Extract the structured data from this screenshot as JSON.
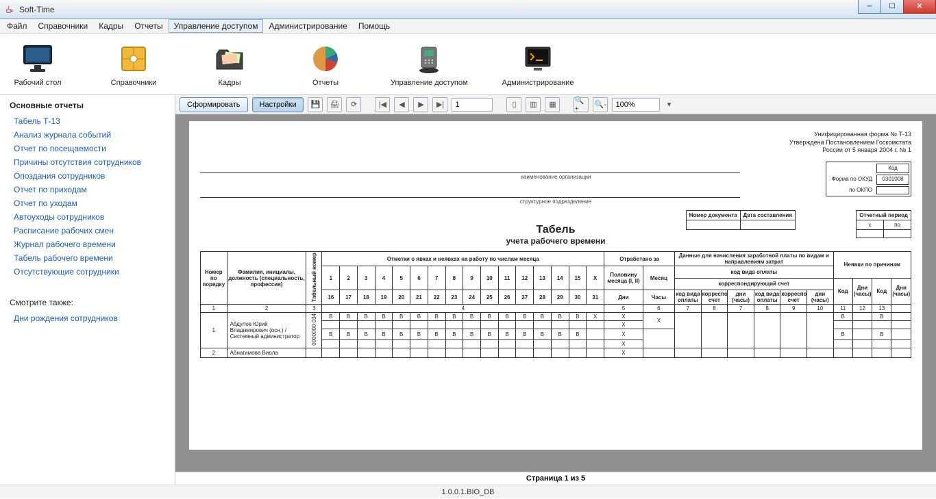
{
  "window": {
    "title": "Soft-Time"
  },
  "menu": {
    "items": [
      "Файл",
      "Справочники",
      "Кадры",
      "Отчеты",
      "Управление доступом",
      "Администрирование",
      "Помощь"
    ],
    "active_index": 4
  },
  "toolstrip": [
    {
      "label": "Рабочий стол",
      "icon": "monitor-icon"
    },
    {
      "label": "Справочники",
      "icon": "archive-icon"
    },
    {
      "label": "Кадры",
      "icon": "folder-people-icon"
    },
    {
      "label": "Отчеты",
      "icon": "pie-chart-icon"
    },
    {
      "label": "Управление доступом",
      "icon": "fingerprint-device-icon"
    },
    {
      "label": "Администрирование",
      "icon": "terminal-icon"
    }
  ],
  "sidebar": {
    "heading1": "Основные отчеты",
    "links1": [
      "Табель Т-13",
      "Анализ журнала событий",
      "Отчет по посещаемости",
      "Причины отсутствия сотрудников",
      "Опоздания сотрудников",
      "Отчет по приходам",
      "Отчет по уходам",
      "Автоуходы сотрудников",
      "Расписание рабочих смен",
      "Журнал рабочего времени",
      "Табель рабочего времени",
      "Отсутствующие сотрудники"
    ],
    "heading2": "Смотрите также:",
    "links2": [
      "Дни рождения сотрудников"
    ]
  },
  "report_toolbar": {
    "btn_generate": "Сформировать",
    "btn_settings": "Настройки",
    "page_value": "1",
    "zoom_value": "100%"
  },
  "report": {
    "form_line1": "Унифицированная форма № Т-13",
    "form_line2": "Утверждена Постановлением Госкомстата",
    "form_line3": "России от 5 января 2004 г. № 1",
    "code_label": "Код",
    "okud_label": "Форма по ОКУД",
    "okud_value": "0301008",
    "okpo_label": "по ОКПО",
    "org_caption": "наименование организации",
    "dept_caption": "структурное подразделение",
    "doc_number_label": "Номер документа",
    "doc_date_label": "Дата составления",
    "period_label": "Отчетный период",
    "period_from": "с",
    "period_to": "по",
    "title": "Табель",
    "subtitle": "учета рабочего времени",
    "headers": {
      "col_num": "Номер по порядку",
      "col_name": "Фамилия, инициалы, должность (специальность, профессия)",
      "col_tabnum": "Табельный номер",
      "marks": "Отметки о явках и неявках на работу по числам месяца",
      "worked": "Отработано за",
      "half_month": "Половину месяца (I, II)",
      "month": "Месяц",
      "days": "Дни",
      "hours": "Часы",
      "payroll": "Данные для начисления заработной платы по видам и направлениям затрат",
      "pay_code": "код вида оплаты",
      "corr_account": "корреспондирующий счет",
      "pay_code_short": "код вида оплаты",
      "corr_short": "корреспондирующий счет",
      "days_hours": "дни (часы)",
      "absences": "Неявки по причинам",
      "abs_code": "Код",
      "abs_days": "Дни (часы)"
    },
    "colnums": [
      "1",
      "2",
      "3",
      "4",
      "5",
      "6",
      "7",
      "8",
      "7",
      "8",
      "9",
      "10",
      "11",
      "12",
      "13"
    ],
    "day_row1": [
      "1",
      "2",
      "3",
      "4",
      "5",
      "6",
      "7",
      "8",
      "9",
      "10",
      "11",
      "12",
      "13",
      "14",
      "15",
      "X"
    ],
    "day_row2": [
      "16",
      "17",
      "18",
      "19",
      "20",
      "21",
      "22",
      "23",
      "24",
      "25",
      "26",
      "27",
      "28",
      "29",
      "30",
      "31"
    ],
    "rows": [
      {
        "n": "1",
        "name": "Абдулов Юрий Владимирович (осн.) / Системный администратор",
        "tab": "0000000 034",
        "marks1": [
          "В",
          "В",
          "В",
          "В",
          "В",
          "В",
          "В",
          "В",
          "В",
          "В",
          "В",
          "В",
          "В",
          "В",
          "В",
          "X"
        ],
        "marks2": [
          "В",
          "В",
          "В",
          "В",
          "В",
          "В",
          "В",
          "В",
          "В",
          "В",
          "В",
          "В",
          "В",
          "В",
          "В",
          ""
        ],
        "half": [
          "X",
          "X",
          "X",
          "X"
        ],
        "month": "X",
        "abs": [
          "В",
          "В",
          "В",
          "В"
        ]
      },
      {
        "n": "2",
        "name": "Абнагимова Виола",
        "tab": "",
        "marks1": [
          "",
          "",
          "",
          "",
          "",
          "",
          "",
          "",
          "",
          "",
          "",
          "",
          "",
          "",
          "",
          ""
        ],
        "marks2": [],
        "half": [
          "X"
        ],
        "month": "",
        "abs": []
      }
    ],
    "page_indicator": "Страница 1 из 5"
  },
  "statusbar": "1.0.0.1.BIO_DB"
}
